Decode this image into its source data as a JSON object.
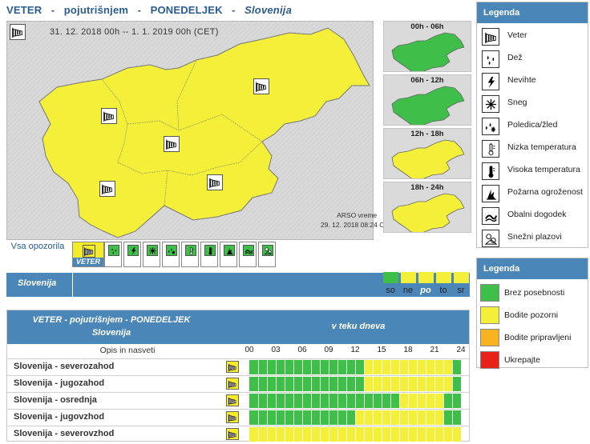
{
  "header": {
    "phenomenon": "VETER",
    "sep": "-",
    "mode": "pojutrišnjem",
    "day": "PONEDELJEK",
    "region": "Slovenija"
  },
  "main_map": {
    "date_range": "31. 12. 2018  00h  --  1. 1. 2019  00h    (CET)",
    "credit_line1": "ARSO vreme",
    "credit_line2": "29. 12. 2018  08:24 CET",
    "fill_color": "#f4f03a",
    "icon": "wind-icon"
  },
  "periods": [
    {
      "label": "00h - 06h",
      "color": "#3fbf4a"
    },
    {
      "label": "06h - 12h",
      "color": "#3fbf4a"
    },
    {
      "label": "12h - 18h",
      "color": "#f4f03a"
    },
    {
      "label": "18h - 24h",
      "color": "#f4f03a"
    }
  ],
  "iconbar": {
    "label": "Vsa opozorila",
    "selected_caption": "VETER",
    "icons": [
      "wind-icon",
      "rain-icon",
      "storm-icon",
      "snow-icon",
      "ice-icon",
      "low-temp-icon",
      "high-temp-icon",
      "fire-icon",
      "coastal-icon",
      "avalanche-icon"
    ]
  },
  "region_bar": {
    "label": "Slovenija"
  },
  "day_selector": {
    "days": [
      {
        "label": "so",
        "color": "#3fbf4a",
        "current": false
      },
      {
        "label": "ne",
        "color": "#f4f03a",
        "current": false
      },
      {
        "label": "po",
        "color": "#f4f03a",
        "current": true
      },
      {
        "label": "to",
        "color": "#f4f03a",
        "current": false
      },
      {
        "label": "sr",
        "color": "#f4f03a",
        "current": false
      }
    ]
  },
  "table": {
    "title1": "VETER - pojutrišnjem - PONEDELJEK",
    "title2": "Slovenija",
    "col_time": "v teku dneva",
    "col_desc": "Opis in nasveti",
    "hours": [
      "00",
      "03",
      "06",
      "09",
      "12",
      "15",
      "18",
      "21",
      "24"
    ],
    "rows": [
      {
        "name": "Slovenija - severozahod",
        "segments": [
          {
            "from": 0,
            "to": 13,
            "color": "#3fbf4a"
          },
          {
            "from": 13,
            "to": 23,
            "color": "#f4f03a"
          },
          {
            "from": 23,
            "to": 24,
            "color": "#3fbf4a"
          }
        ]
      },
      {
        "name": "Slovenija - jugozahod",
        "segments": [
          {
            "from": 0,
            "to": 13,
            "color": "#3fbf4a"
          },
          {
            "from": 13,
            "to": 23,
            "color": "#f4f03a"
          },
          {
            "from": 23,
            "to": 24,
            "color": "#3fbf4a"
          }
        ]
      },
      {
        "name": "Slovenija - osrednja",
        "segments": [
          {
            "from": 0,
            "to": 17,
            "color": "#3fbf4a"
          },
          {
            "from": 17,
            "to": 22,
            "color": "#f4f03a"
          },
          {
            "from": 22,
            "to": 24,
            "color": "#3fbf4a"
          }
        ]
      },
      {
        "name": "Slovenija - jugovzhod",
        "segments": [
          {
            "from": 0,
            "to": 12,
            "color": "#3fbf4a"
          },
          {
            "from": 12,
            "to": 22,
            "color": "#f4f03a"
          },
          {
            "from": 22,
            "to": 24,
            "color": "#3fbf4a"
          }
        ]
      },
      {
        "name": "Slovenija - severovzhod",
        "segments": [
          {
            "from": 0,
            "to": 24,
            "color": "#f4f03a"
          }
        ]
      }
    ]
  },
  "legend": {
    "title": "Legenda",
    "items": [
      {
        "label": "Veter",
        "icon": "wind-icon"
      },
      {
        "label": "Dež",
        "icon": "rain-icon"
      },
      {
        "label": "Nevihte",
        "icon": "storm-icon"
      },
      {
        "label": "Sneg",
        "icon": "snow-icon"
      },
      {
        "label": "Poledica/žled",
        "icon": "ice-icon"
      },
      {
        "label": "Nizka temperatura",
        "icon": "low-temp-icon"
      },
      {
        "label": "Visoka temperatura",
        "icon": "high-temp-icon"
      },
      {
        "label": "Požarna ogroženost",
        "icon": "fire-icon"
      },
      {
        "label": "Obalni dogodek",
        "icon": "coastal-icon"
      },
      {
        "label": "Snežni plazovi",
        "icon": "avalanche-icon"
      }
    ]
  },
  "legend2": {
    "title": "Legenda",
    "items": [
      {
        "label": "Brez posebnosti",
        "color": "#3fbf4a"
      },
      {
        "label": "Bodite pozorni",
        "color": "#f4f03a"
      },
      {
        "label": "Bodite pripravljeni",
        "color": "#f8b323"
      },
      {
        "label": "Ukrepajte",
        "color": "#e8231c"
      }
    ]
  }
}
